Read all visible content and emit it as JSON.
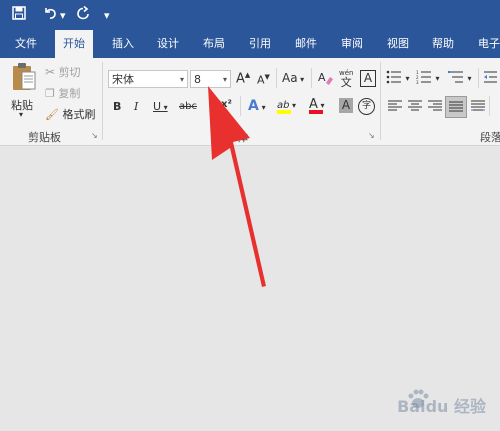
{
  "quick_access": {
    "save_icon": "save-icon",
    "undo_icon": "undo-icon",
    "redo_icon": "redo-icon",
    "customize_icon": "customize-qat-icon"
  },
  "tabs": [
    {
      "label": "文件"
    },
    {
      "label": "开始"
    },
    {
      "label": "插入"
    },
    {
      "label": "设计"
    },
    {
      "label": "布局"
    },
    {
      "label": "引用"
    },
    {
      "label": "邮件"
    },
    {
      "label": "审阅"
    },
    {
      "label": "视图"
    },
    {
      "label": "帮助"
    },
    {
      "label": "电子"
    }
  ],
  "clipboard": {
    "paste": "粘贴",
    "cut": "剪切",
    "copy": "复制",
    "format_painter": "格式刷",
    "group_label": "剪贴板"
  },
  "font": {
    "font_name": "宋体",
    "font_size": "8",
    "group_label": "字体",
    "grow": "A",
    "shrink": "A",
    "change_case": "Aa",
    "clear_format_icon": "eraser-icon",
    "phonetic": "wén",
    "border_char": "A",
    "bold": "B",
    "italic": "I",
    "underline": "U",
    "strike": "abc",
    "superscript": "x²",
    "text_effect": "A",
    "highlight": "ab",
    "font_color": "A",
    "shading": "A",
    "enclose": "字"
  },
  "paragraph": {
    "group_label": "段落"
  },
  "colors": {
    "brand_blue": "#2b579a",
    "highlight_yellow": "#ffff00",
    "font_color_red": "#e81123",
    "arrow_red": "#e8312f"
  },
  "watermark": {
    "text": "Baidu 经验"
  }
}
